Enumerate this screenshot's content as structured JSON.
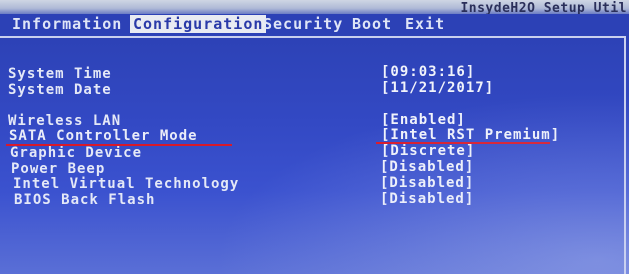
{
  "vendor_title": "InsydeH2O Setup Util",
  "menu": {
    "tabs": [
      {
        "label": "Information"
      },
      {
        "label": "Configuration"
      },
      {
        "label": "Security"
      },
      {
        "label": "Boot"
      },
      {
        "label": "Exit"
      }
    ],
    "active": "Configuration"
  },
  "settings": [
    {
      "label": "System Time",
      "value": "[09:03:16]"
    },
    {
      "label": "System Date",
      "value": "[11/21/2017]"
    },
    {
      "label": "Wireless LAN",
      "value": "[Enabled]"
    },
    {
      "label": "SATA Controller Mode",
      "value": "[Intel RST Premium]"
    },
    {
      "label": "Graphic Device",
      "value": "[Discrete]"
    },
    {
      "label": "Power Beep",
      "value": "[Disabled]"
    },
    {
      "label": "Intel Virtual Technology",
      "value": "[Disabled]"
    },
    {
      "label": "BIOS Back Flash",
      "value": "[Disabled]"
    }
  ],
  "highlight_color": "#d8192a"
}
